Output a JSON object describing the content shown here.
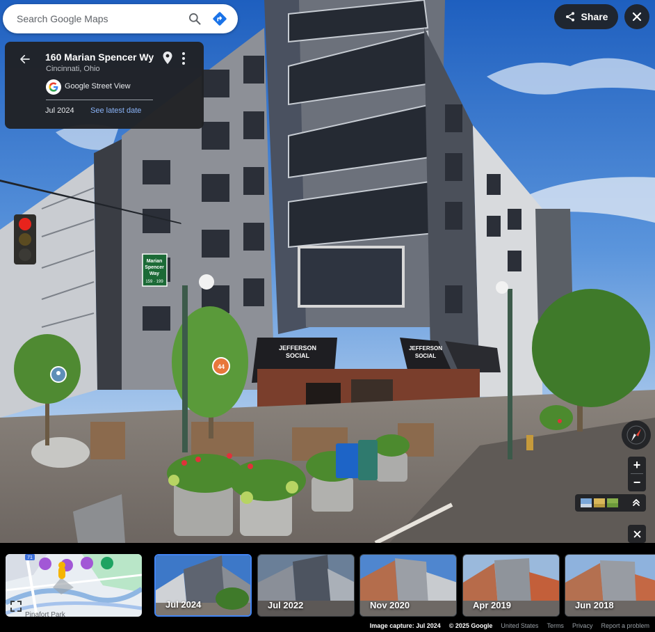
{
  "search": {
    "placeholder": "Search Google Maps"
  },
  "card": {
    "title": "160 Marian Spencer Wy",
    "subtitle": "Cincinnati, Ohio",
    "source": "Google Street View",
    "date": "Jul 2024",
    "latest_link": "See latest date"
  },
  "share": {
    "label": "Share"
  },
  "zoom": {
    "in": "+",
    "out": "−"
  },
  "signs": {
    "street_1": "Marian",
    "street_2": "Spencer",
    "street_3": "Way",
    "street_4": "159 · 199",
    "awning_1a": "JEFFERSON",
    "awning_1b": "SOCIAL",
    "awning_2a": "JEFFERSON",
    "awning_2b": "SOCIAL",
    "poi_number": "44"
  },
  "timeline": [
    {
      "label": "Jul 2024",
      "selected": true
    },
    {
      "label": "Jul 2022",
      "selected": false
    },
    {
      "label": "Nov 2020",
      "selected": false
    },
    {
      "label": "Apr 2019",
      "selected": false
    },
    {
      "label": "Jun 2018",
      "selected": false
    }
  ],
  "minimap": {
    "road_label": "Pinafort Park",
    "route_number": "71"
  },
  "footer": {
    "capture": "Image capture: Jul 2024",
    "copyright": "© 2025 Google",
    "country": "United States",
    "terms": "Terms",
    "privacy": "Privacy",
    "report": "Report a problem"
  },
  "colors": {
    "accent": "#4285f4",
    "link": "#8ab4f8",
    "panel": "#202124",
    "sky": "#2f6fc9"
  },
  "icons": [
    "search-icon",
    "directions-icon",
    "back-arrow-icon",
    "pin-icon",
    "more-vert-icon",
    "google-logo-icon",
    "share-icon",
    "close-icon",
    "compass-icon",
    "expand-icon",
    "fullscreen-icon"
  ]
}
